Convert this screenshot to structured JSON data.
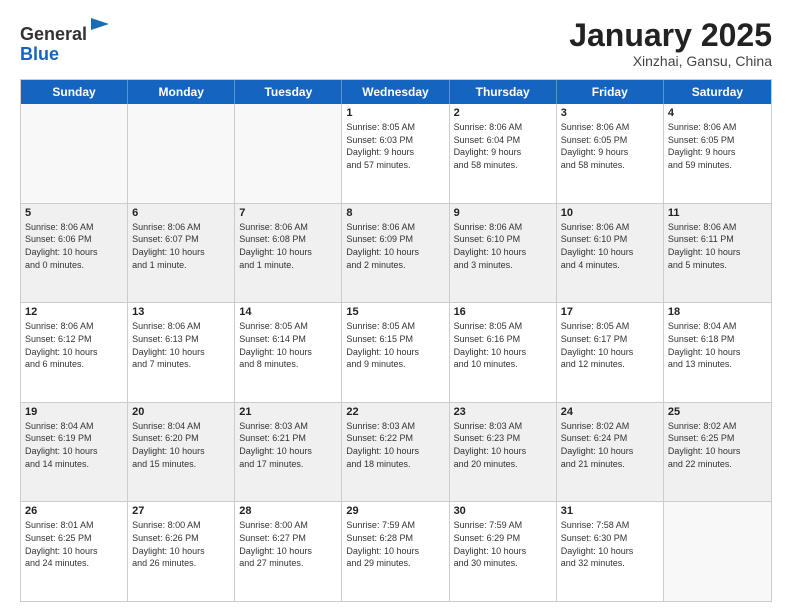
{
  "header": {
    "logo_general": "General",
    "logo_blue": "Blue",
    "month_title": "January 2025",
    "subtitle": "Xinzhai, Gansu, China"
  },
  "weekdays": [
    "Sunday",
    "Monday",
    "Tuesday",
    "Wednesday",
    "Thursday",
    "Friday",
    "Saturday"
  ],
  "weeks": [
    [
      {
        "day": "",
        "info": "",
        "empty": true
      },
      {
        "day": "",
        "info": "",
        "empty": true
      },
      {
        "day": "",
        "info": "",
        "empty": true
      },
      {
        "day": "1",
        "info": "Sunrise: 8:05 AM\nSunset: 6:03 PM\nDaylight: 9 hours\nand 57 minutes."
      },
      {
        "day": "2",
        "info": "Sunrise: 8:06 AM\nSunset: 6:04 PM\nDaylight: 9 hours\nand 58 minutes."
      },
      {
        "day": "3",
        "info": "Sunrise: 8:06 AM\nSunset: 6:05 PM\nDaylight: 9 hours\nand 58 minutes."
      },
      {
        "day": "4",
        "info": "Sunrise: 8:06 AM\nSunset: 6:05 PM\nDaylight: 9 hours\nand 59 minutes."
      }
    ],
    [
      {
        "day": "5",
        "info": "Sunrise: 8:06 AM\nSunset: 6:06 PM\nDaylight: 10 hours\nand 0 minutes."
      },
      {
        "day": "6",
        "info": "Sunrise: 8:06 AM\nSunset: 6:07 PM\nDaylight: 10 hours\nand 1 minute."
      },
      {
        "day": "7",
        "info": "Sunrise: 8:06 AM\nSunset: 6:08 PM\nDaylight: 10 hours\nand 1 minute."
      },
      {
        "day": "8",
        "info": "Sunrise: 8:06 AM\nSunset: 6:09 PM\nDaylight: 10 hours\nand 2 minutes."
      },
      {
        "day": "9",
        "info": "Sunrise: 8:06 AM\nSunset: 6:10 PM\nDaylight: 10 hours\nand 3 minutes."
      },
      {
        "day": "10",
        "info": "Sunrise: 8:06 AM\nSunset: 6:10 PM\nDaylight: 10 hours\nand 4 minutes."
      },
      {
        "day": "11",
        "info": "Sunrise: 8:06 AM\nSunset: 6:11 PM\nDaylight: 10 hours\nand 5 minutes."
      }
    ],
    [
      {
        "day": "12",
        "info": "Sunrise: 8:06 AM\nSunset: 6:12 PM\nDaylight: 10 hours\nand 6 minutes."
      },
      {
        "day": "13",
        "info": "Sunrise: 8:06 AM\nSunset: 6:13 PM\nDaylight: 10 hours\nand 7 minutes."
      },
      {
        "day": "14",
        "info": "Sunrise: 8:05 AM\nSunset: 6:14 PM\nDaylight: 10 hours\nand 8 minutes."
      },
      {
        "day": "15",
        "info": "Sunrise: 8:05 AM\nSunset: 6:15 PM\nDaylight: 10 hours\nand 9 minutes."
      },
      {
        "day": "16",
        "info": "Sunrise: 8:05 AM\nSunset: 6:16 PM\nDaylight: 10 hours\nand 10 minutes."
      },
      {
        "day": "17",
        "info": "Sunrise: 8:05 AM\nSunset: 6:17 PM\nDaylight: 10 hours\nand 12 minutes."
      },
      {
        "day": "18",
        "info": "Sunrise: 8:04 AM\nSunset: 6:18 PM\nDaylight: 10 hours\nand 13 minutes."
      }
    ],
    [
      {
        "day": "19",
        "info": "Sunrise: 8:04 AM\nSunset: 6:19 PM\nDaylight: 10 hours\nand 14 minutes."
      },
      {
        "day": "20",
        "info": "Sunrise: 8:04 AM\nSunset: 6:20 PM\nDaylight: 10 hours\nand 15 minutes."
      },
      {
        "day": "21",
        "info": "Sunrise: 8:03 AM\nSunset: 6:21 PM\nDaylight: 10 hours\nand 17 minutes."
      },
      {
        "day": "22",
        "info": "Sunrise: 8:03 AM\nSunset: 6:22 PM\nDaylight: 10 hours\nand 18 minutes."
      },
      {
        "day": "23",
        "info": "Sunrise: 8:03 AM\nSunset: 6:23 PM\nDaylight: 10 hours\nand 20 minutes."
      },
      {
        "day": "24",
        "info": "Sunrise: 8:02 AM\nSunset: 6:24 PM\nDaylight: 10 hours\nand 21 minutes."
      },
      {
        "day": "25",
        "info": "Sunrise: 8:02 AM\nSunset: 6:25 PM\nDaylight: 10 hours\nand 22 minutes."
      }
    ],
    [
      {
        "day": "26",
        "info": "Sunrise: 8:01 AM\nSunset: 6:25 PM\nDaylight: 10 hours\nand 24 minutes."
      },
      {
        "day": "27",
        "info": "Sunrise: 8:00 AM\nSunset: 6:26 PM\nDaylight: 10 hours\nand 26 minutes."
      },
      {
        "day": "28",
        "info": "Sunrise: 8:00 AM\nSunset: 6:27 PM\nDaylight: 10 hours\nand 27 minutes."
      },
      {
        "day": "29",
        "info": "Sunrise: 7:59 AM\nSunset: 6:28 PM\nDaylight: 10 hours\nand 29 minutes."
      },
      {
        "day": "30",
        "info": "Sunrise: 7:59 AM\nSunset: 6:29 PM\nDaylight: 10 hours\nand 30 minutes."
      },
      {
        "day": "31",
        "info": "Sunrise: 7:58 AM\nSunset: 6:30 PM\nDaylight: 10 hours\nand 32 minutes."
      },
      {
        "day": "",
        "info": "",
        "empty": true
      }
    ]
  ]
}
